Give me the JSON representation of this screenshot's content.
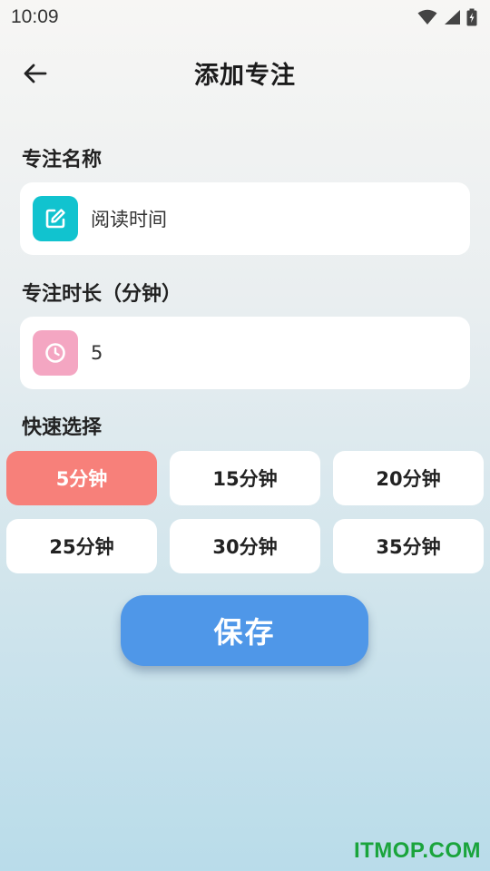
{
  "status_bar": {
    "time": "10:09"
  },
  "header": {
    "title": "添加专注"
  },
  "name_section": {
    "label": "专注名称",
    "value": "阅读时间"
  },
  "duration_section": {
    "label": "专注时长（分钟）",
    "value": "5"
  },
  "quick_select": {
    "label": "快速选择",
    "options": [
      "5分钟",
      "15分钟",
      "20分钟",
      "25分钟",
      "30分钟",
      "35分钟"
    ],
    "selected": "5分钟"
  },
  "save_label": "保存",
  "watermark": "ITMOP.COM",
  "colors": {
    "accent_teal": "#11c3cf",
    "accent_pink": "#f4a6c2",
    "chip_active": "#f7807a",
    "save_button": "#4f97e8"
  },
  "icons": {
    "back": "arrow-left-icon",
    "name_field": "edit-icon",
    "duration_field": "clock-icon"
  }
}
